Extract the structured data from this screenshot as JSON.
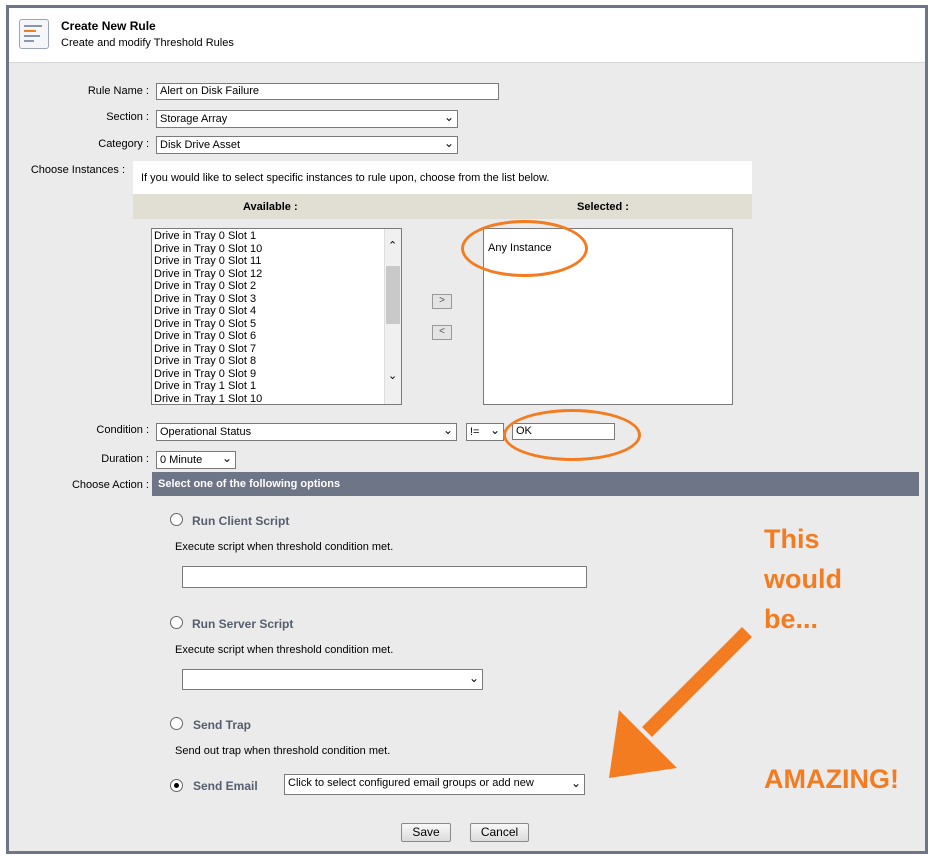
{
  "header": {
    "title": "Create New Rule",
    "subtitle": "Create and modify Threshold Rules",
    "icon": "rules-document-icon"
  },
  "form": {
    "rule_name_label": "Rule Name :",
    "rule_name_value": "Alert on Disk Failure",
    "section_label": "Section :",
    "section_value": "Storage Array",
    "category_label": "Category :",
    "category_value": "Disk Drive Asset",
    "instances_label": "Choose Instances :",
    "instances_hint": "If you would like to select specific instances to rule upon, choose from the list below.",
    "available_header": "Available :",
    "selected_header": "Selected :",
    "available_items": [
      "Drive in Tray 0 Slot 1",
      "Drive in Tray 0 Slot 10",
      "Drive in Tray 0 Slot 11",
      "Drive in Tray 0 Slot 12",
      "Drive in Tray 0 Slot 2",
      "Drive in Tray 0 Slot 3",
      "Drive in Tray 0 Slot 4",
      "Drive in Tray 0 Slot 5",
      "Drive in Tray 0 Slot 6",
      "Drive in Tray 0 Slot 7",
      "Drive in Tray 0 Slot 8",
      "Drive in Tray 0 Slot 9",
      "Drive in Tray 1 Slot 1",
      "Drive in Tray 1 Slot 10"
    ],
    "selected_items": [
      "Any Instance"
    ],
    "move_right": ">",
    "move_left": "<",
    "condition_label": "Condition :",
    "condition_value": "Operational Status",
    "operator_value": "!=",
    "condition_compare_value": "OK",
    "duration_label": "Duration :",
    "duration_value": "0 Minute",
    "action_label": "Choose Action :",
    "action_banner": "Select one of the following options"
  },
  "actions": {
    "client_script": {
      "title": "Run Client Script",
      "desc": "Execute script when threshold condition met.",
      "value": ""
    },
    "server_script": {
      "title": "Run Server Script",
      "desc": "Execute script when threshold condition met.",
      "value": ""
    },
    "trap": {
      "title": "Send Trap",
      "desc": "Send out trap when threshold condition met."
    },
    "email": {
      "title": "Send Email",
      "select_value": "Click to select configured email groups or add new",
      "checked": true
    }
  },
  "buttons": {
    "save": "Save",
    "cancel": "Cancel"
  },
  "annotation": {
    "line1": "This",
    "line2": "would",
    "line3": "be...",
    "line4": "AMAZING!",
    "color": "#f47c20"
  },
  "colors": {
    "frame": "#6e7586",
    "banner": "#6e7586",
    "available_header_bg": "#e1ded4"
  }
}
